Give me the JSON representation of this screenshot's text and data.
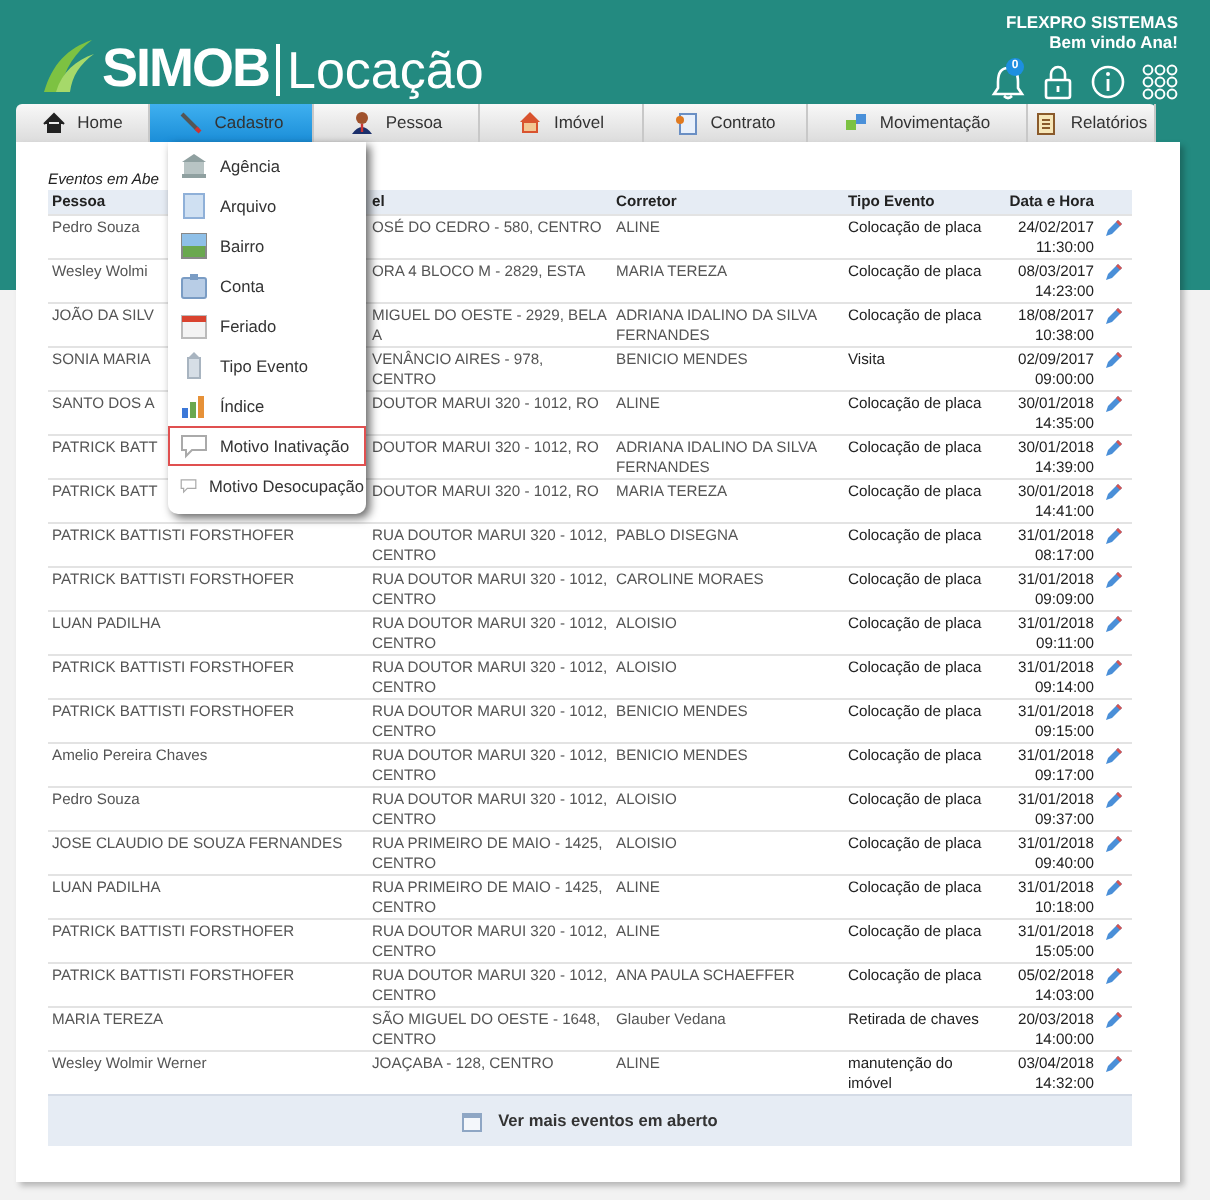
{
  "header": {
    "logo": "SIMOB",
    "product": "Locação",
    "company": "FLEXPRO SISTEMAS",
    "welcome": "Bem vindo Ana!",
    "notifications": "0"
  },
  "nav": [
    {
      "label": "Home",
      "selected": false
    },
    {
      "label": "Cadastro",
      "selected": true
    },
    {
      "label": "Pessoa",
      "selected": false
    },
    {
      "label": "Imóvel",
      "selected": false
    },
    {
      "label": "Contrato",
      "selected": false
    },
    {
      "label": "Movimentação",
      "selected": false
    },
    {
      "label": "Relatórios",
      "selected": false
    }
  ],
  "menu": {
    "expanded": true,
    "items": [
      {
        "label": "Agência",
        "selected": false
      },
      {
        "label": "Arquivo",
        "selected": false
      },
      {
        "label": "Bairro",
        "selected": false
      },
      {
        "label": "Conta",
        "selected": false
      },
      {
        "label": "Feriado",
        "selected": false
      },
      {
        "label": "Tipo Evento",
        "selected": false
      },
      {
        "label": "Índice",
        "selected": false
      },
      {
        "label": "Motivo Inativação",
        "selected": true
      },
      {
        "label": "Motivo Desocupação",
        "selected": false
      }
    ]
  },
  "events": {
    "caption": "Eventos em Abe",
    "columns": [
      "Pessoa",
      "el",
      "Corretor",
      "Tipo Evento",
      "Data e Hora"
    ],
    "rows": [
      {
        "pessoa": "Pedro Souza",
        "imovel": "OSÉ DO CEDRO - 580, CENTRO",
        "corretor": "ALINE",
        "tipo": "Colocação de placa",
        "date": "24/02/2017",
        "time": "11:30:00"
      },
      {
        "pessoa": "Wesley Wolmi",
        "imovel": "ORA 4 BLOCO M - 2829, ESTA",
        "corretor": "MARIA TEREZA",
        "tipo": "Colocação de placa",
        "date": "08/03/2017",
        "time": "14:23:00"
      },
      {
        "pessoa": "JOÃO DA SILV",
        "imovel": "MIGUEL DO OESTE - 2929, BELA A",
        "corretor": "ADRIANA IDALINO DA SILVA FERNANDES",
        "tipo": "Colocação de placa",
        "date": "18/08/2017",
        "time": "10:38:00"
      },
      {
        "pessoa": "SONIA MARIA",
        "imovel": "VENÂNCIO AIRES - 978, CENTRO",
        "corretor": "BENICIO MENDES",
        "tipo": "Visita",
        "date": "02/09/2017",
        "time": "09:00:00"
      },
      {
        "pessoa": "SANTO DOS A",
        "imovel": "DOUTOR MARUI 320 - 1012, RO",
        "corretor": "ALINE",
        "tipo": "Colocação de placa",
        "date": "30/01/2018",
        "time": "14:35:00"
      },
      {
        "pessoa": "PATRICK BATT",
        "imovel": "DOUTOR MARUI 320 - 1012, RO",
        "corretor": "ADRIANA IDALINO DA SILVA FERNANDES",
        "tipo": "Colocação de placa",
        "date": "30/01/2018",
        "time": "14:39:00"
      },
      {
        "pessoa": "PATRICK BATT",
        "imovel": "DOUTOR MARUI 320 - 1012, RO",
        "corretor": "MARIA TEREZA",
        "tipo": "Colocação de placa",
        "date": "30/01/2018",
        "time": "14:41:00"
      },
      {
        "pessoa": "PATRICK BATTISTI FORSTHOFER",
        "imovel": "RUA DOUTOR MARUI 320 - 1012, CENTRO",
        "corretor": "PABLO DISEGNA",
        "tipo": "Colocação de placa",
        "date": "31/01/2018",
        "time": "08:17:00"
      },
      {
        "pessoa": "PATRICK BATTISTI FORSTHOFER",
        "imovel": "RUA DOUTOR MARUI 320 - 1012, CENTRO",
        "corretor": "CAROLINE MORAES",
        "tipo": "Colocação de placa",
        "date": "31/01/2018",
        "time": "09:09:00"
      },
      {
        "pessoa": "LUAN PADILHA",
        "imovel": "RUA DOUTOR MARUI 320 - 1012, CENTRO",
        "corretor": "ALOISIO",
        "tipo": "Colocação de placa",
        "date": "31/01/2018",
        "time": "09:11:00"
      },
      {
        "pessoa": "PATRICK BATTISTI FORSTHOFER",
        "imovel": "RUA DOUTOR MARUI 320 - 1012, CENTRO",
        "corretor": "ALOISIO",
        "tipo": "Colocação de placa",
        "date": "31/01/2018",
        "time": "09:14:00"
      },
      {
        "pessoa": "PATRICK BATTISTI FORSTHOFER",
        "imovel": "RUA DOUTOR MARUI 320 - 1012, CENTRO",
        "corretor": "BENICIO MENDES",
        "tipo": "Colocação de placa",
        "date": "31/01/2018",
        "time": "09:15:00"
      },
      {
        "pessoa": "Amelio Pereira Chaves",
        "imovel": "RUA DOUTOR MARUI 320 - 1012, CENTRO",
        "corretor": "BENICIO MENDES",
        "tipo": "Colocação de placa",
        "date": "31/01/2018",
        "time": "09:17:00"
      },
      {
        "pessoa": "Pedro Souza",
        "imovel": "RUA DOUTOR MARUI 320 - 1012, CENTRO",
        "corretor": "ALOISIO",
        "tipo": "Colocação de placa",
        "date": "31/01/2018",
        "time": "09:37:00"
      },
      {
        "pessoa": "JOSE CLAUDIO DE SOUZA FERNANDES",
        "imovel": "RUA PRIMEIRO DE MAIO - 1425, CENTRO",
        "corretor": "ALOISIO",
        "tipo": "Colocação de placa",
        "date": "31/01/2018",
        "time": "09:40:00"
      },
      {
        "pessoa": "LUAN PADILHA",
        "imovel": "RUA PRIMEIRO DE MAIO - 1425, CENTRO",
        "corretor": "ALINE",
        "tipo": "Colocação de placa",
        "date": "31/01/2018",
        "time": "10:18:00"
      },
      {
        "pessoa": "PATRICK BATTISTI FORSTHOFER",
        "imovel": "RUA DOUTOR MARUI 320 - 1012, CENTRO",
        "corretor": "ALINE",
        "tipo": "Colocação de placa",
        "date": "31/01/2018",
        "time": "15:05:00"
      },
      {
        "pessoa": "PATRICK BATTISTI FORSTHOFER",
        "imovel": "RUA DOUTOR MARUI 320 - 1012, CENTRO",
        "corretor": "ANA PAULA SCHAEFFER",
        "tipo": "Colocação de placa",
        "date": "05/02/2018",
        "time": "14:03:00"
      },
      {
        "pessoa": "MARIA TEREZA",
        "imovel": "SÃO MIGUEL DO OESTE - 1648, CENTRO",
        "corretor": "Glauber Vedana",
        "tipo": "Retirada de chaves",
        "date": "20/03/2018",
        "time": "14:00:00"
      },
      {
        "pessoa": "Wesley Wolmir Werner",
        "imovel": "JOAÇABA - 128, CENTRO",
        "corretor": "ALINE",
        "tipo": "manutenção do imóvel",
        "date": "03/04/2018",
        "time": "14:32:00"
      }
    ],
    "more_button": "Ver mais eventos em aberto"
  }
}
